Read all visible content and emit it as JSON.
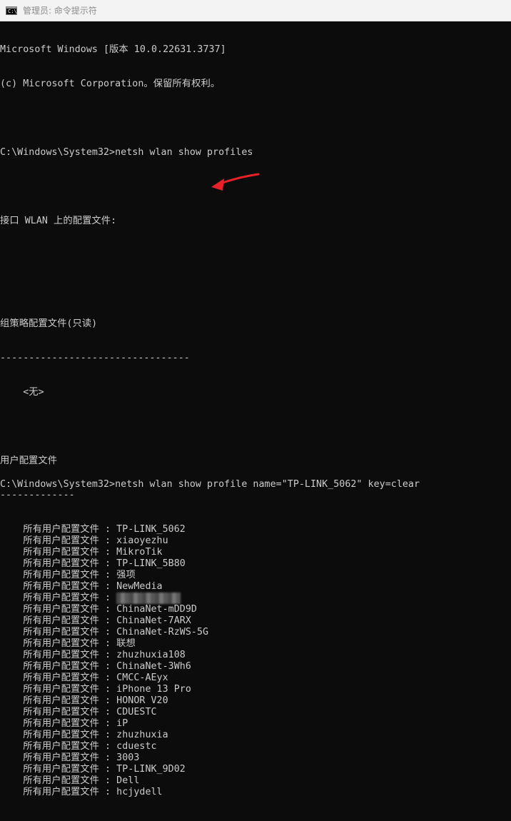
{
  "window": {
    "title": "管理员: 命令提示符",
    "icon": "cmd-icon"
  },
  "console": {
    "header1": "Microsoft Windows [版本 10.0.22631.3737]",
    "header2": "(c) Microsoft Corporation。保留所有权利。",
    "command1": "C:\\Windows\\System32>netsh wlan show profiles",
    "interface_line": "接口 WLAN 上的配置文件:",
    "group_policy_title": "组策略配置文件(只读)",
    "group_policy_sep": "---------------------------------",
    "group_policy_none": "    <无>",
    "user_profiles_title": "用户配置文件",
    "user_profiles_sep": "-------------",
    "profile_prefix": "    所有用户配置文件 : ",
    "profiles": [
      "TP-LINK_5062",
      "xiaoyezhu",
      "MikroTik",
      "TP-LINK_5B80",
      "强项",
      "NewMedia",
      "",
      "ChinaNet-mDD9D",
      "ChinaNet-7ARX",
      "ChinaNet-RzWS-5G",
      "联想",
      "zhuzhuxia108",
      "ChinaNet-3Wh6",
      "CMCC-AEyx",
      "iPhone 13 Pro",
      "HONOR V20",
      "CDUESTC",
      "iP",
      "zhuzhuxia",
      "cduestc",
      "3003",
      "TP-LINK_9D02",
      "Dell",
      "hcjydell"
    ],
    "command2": "C:\\Windows\\System32>netsh wlan show profile name=\"TP-LINK_5062\" key=clear"
  },
  "annotation": {
    "arrow_color": "#e8202a",
    "arrow_icon": "red-arrow-icon"
  },
  "colors": {
    "console_bg": "#0c0c0c",
    "console_fg": "#cccccc",
    "titlebar_bg": "#f3f3f3"
  }
}
